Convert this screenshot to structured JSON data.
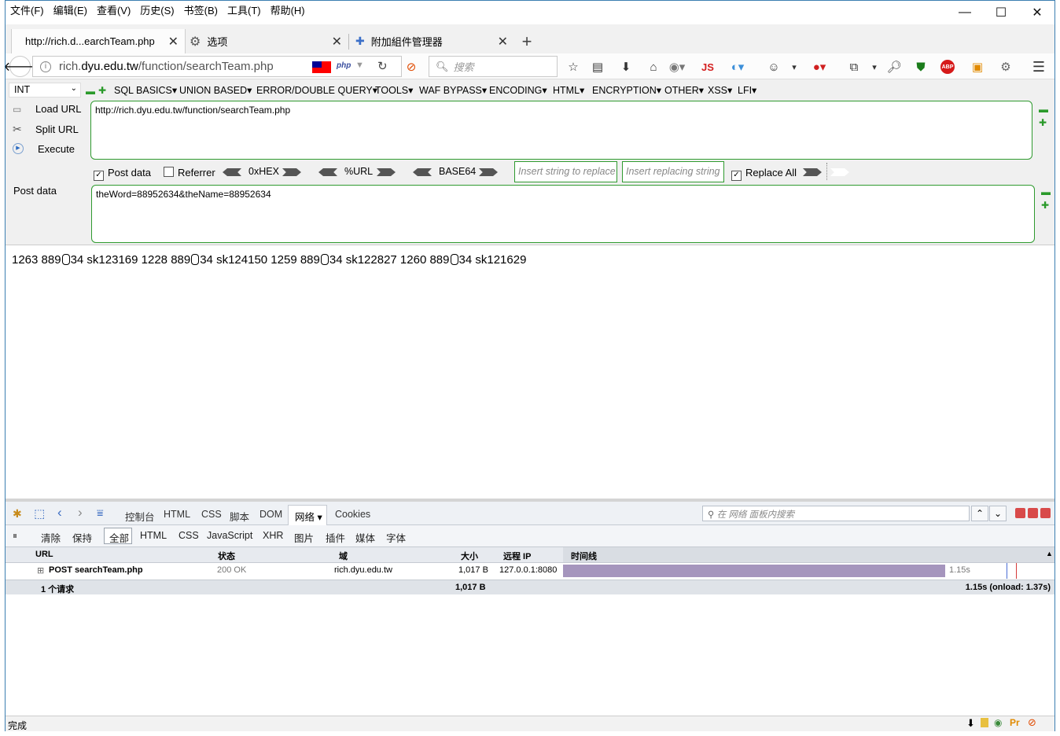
{
  "menubar": {
    "items": [
      "文件(F)",
      "编辑(E)",
      "查看(V)",
      "历史(S)",
      "书签(B)",
      "工具(T)",
      "帮助(H)"
    ]
  },
  "window_controls": {
    "minimize": "—",
    "maximize": "☐",
    "close": "✕"
  },
  "tabs": [
    {
      "label": "http://rich.d...earchTeam.php",
      "active": true
    },
    {
      "label": "选项",
      "active": false
    },
    {
      "label": "附加組件管理器",
      "active": false
    }
  ],
  "new_tab": "+",
  "navbar": {
    "url_prefix": "rich.",
    "url_domain": "dyu.edu.tw",
    "url_path": "/function/searchTeam.php",
    "php_badge": "php",
    "search_placeholder": "搜索",
    "js_badge": "JS",
    "abp_badge": "ABP"
  },
  "hackbar": {
    "method_select": "INT",
    "menus": [
      "SQL BASICS▾",
      "UNION BASED▾",
      "ERROR/DOUBLE QUERY▾",
      "TOOLS▾",
      "WAF BYPASS▾",
      "ENCODING▾",
      "HTML▾",
      "ENCRYPTION▾",
      "OTHER▾",
      "XSS▾",
      "LFI▾"
    ],
    "load_url": "Load URL",
    "split_url": "Split URL",
    "execute": "Execute",
    "url_value": "http://rich.dyu.edu.tw/function/searchTeam.php",
    "post_data_checkbox": "Post data",
    "post_data_checked": true,
    "referrer_checkbox": "Referrer",
    "referrer_checked": false,
    "hex_label": "0xHEX",
    "url_label": "%URL",
    "base64_label": "BASE64",
    "insert_replace_placeholder": "Insert string to replace",
    "insert_replacing_placeholder": "Insert replacing string",
    "replace_all": "Replace All",
    "replace_all_checked": true,
    "post_data_label": "Post data",
    "post_data_value": "theWord=88952634&theName=88952634"
  },
  "content": {
    "result_parts": [
      "1263 889",
      "34 sk123169 1228 889",
      "34 sk124150 1259 889",
      "34 sk122827 1260 889",
      "34 sk121629"
    ]
  },
  "devtools": {
    "tabs": [
      "控制台",
      "HTML",
      "CSS",
      "脚本",
      "DOM",
      "网络 ▾",
      "Cookies"
    ],
    "active_tab": "网络 ▾",
    "search_placeholder": "在 网络 面板内搜索",
    "sub_buttons": [
      "清除",
      "保持"
    ],
    "filters": [
      "全部",
      "HTML",
      "CSS",
      "JavaScript",
      "XHR",
      "图片",
      "插件",
      "媒体",
      "字体"
    ],
    "active_filter": "全部",
    "columns": [
      "URL",
      "状态",
      "域",
      "大小",
      "远程 IP",
      "时间线"
    ],
    "request": {
      "expand": "⊞",
      "url": "POST searchTeam.php",
      "status": "200 OK",
      "domain": "rich.dyu.edu.tw",
      "size": "1,017 B",
      "remote_ip": "127.0.0.1:8080",
      "time": "1.15s",
      "timeline_fraction": 0.76
    },
    "summary": {
      "count": "1 个请求",
      "size": "1,017 B",
      "timing": "1.15s (onload: 1.37s)"
    }
  },
  "statusbar": {
    "text": "完成"
  },
  "colors": {
    "accent_green": "#2f9a2f",
    "timeline_purple": "#a595bd",
    "window_border": "#3c7fb1"
  }
}
